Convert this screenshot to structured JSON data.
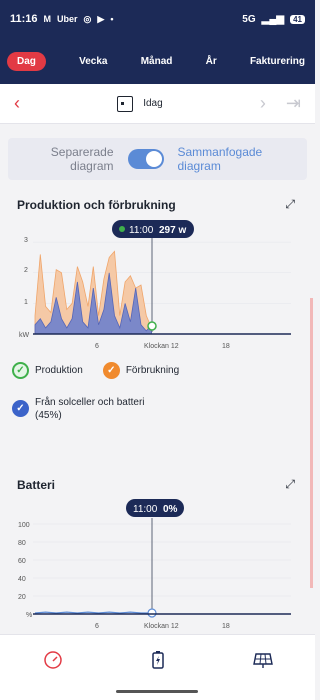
{
  "status": {
    "time": "11:16",
    "icons": [
      "gmail-icon",
      "uber-icon",
      "record-icon",
      "youtube-icon",
      "dot-icon"
    ],
    "uber_label": "Uber",
    "network": "5G",
    "battery": "41"
  },
  "tabs": [
    {
      "label": "Dag",
      "active": true
    },
    {
      "label": "Vecka"
    },
    {
      "label": "Månad"
    },
    {
      "label": "År"
    },
    {
      "label": "Fakturering"
    }
  ],
  "date": {
    "label": "Idag"
  },
  "view": {
    "left": "Separerade diagram",
    "right": "Sammanfogade diagram",
    "toggle_on": true
  },
  "production": {
    "title": "Produktion och förbrukning",
    "tooltip_time": "11:00",
    "tooltip_value": "297 w",
    "y_ticks": [
      "3",
      "2",
      "1",
      "kW"
    ],
    "x_ticks": [
      "6",
      "Klockan 12",
      "18"
    ]
  },
  "legend": {
    "produktion": "Produktion",
    "forbrukning": "Förbrukning",
    "solar_battery": "Från solceller och batteri",
    "solar_battery_pct": "(45%)"
  },
  "battery": {
    "title": "Batteri",
    "tooltip_time": "11:00",
    "tooltip_value": "0%",
    "y_ticks": [
      "100",
      "80",
      "60",
      "40",
      "20",
      "%"
    ],
    "x_ticks": [
      "6",
      "Klockan 12",
      "18"
    ]
  },
  "chart_data": [
    {
      "type": "area",
      "title": "Produktion och förbrukning",
      "ylabel": "kW",
      "ylim": [
        0,
        3.2
      ],
      "x_ticks": [
        "6",
        "Klockan 12",
        "18"
      ],
      "series": [
        {
          "name": "Förbrukning",
          "color": "#f5c9a6",
          "x": [
            0,
            0.5,
            1,
            1.5,
            2,
            2.5,
            3,
            3.5,
            4,
            4.5,
            5,
            5.5,
            6,
            6.5,
            7,
            7.5,
            8,
            8.5,
            9,
            9.5,
            10,
            10.5,
            11
          ],
          "values": [
            0.6,
            2.6,
            0.9,
            0.7,
            2.1,
            2.0,
            0.8,
            1.0,
            2.2,
            1.7,
            0.9,
            2.2,
            0.6,
            1.8,
            2.5,
            2.7,
            0.6,
            1.7,
            1.9,
            1.5,
            1.6,
            0.6,
            0.2
          ]
        },
        {
          "name": "Från solceller och batteri",
          "color": "#7b88c9",
          "x": [
            0,
            0.5,
            1,
            1.5,
            2,
            2.5,
            3,
            3.5,
            4,
            4.5,
            5,
            5.5,
            6,
            6.5,
            7,
            7.5,
            8,
            8.5,
            9,
            9.5,
            10,
            10.5,
            11
          ],
          "values": [
            0.3,
            0.5,
            0.2,
            0.4,
            1.2,
            0.5,
            0.2,
            0.5,
            1.7,
            0.4,
            0.2,
            1.5,
            0.3,
            0.8,
            2.0,
            0.6,
            0.2,
            1.0,
            0.4,
            1.5,
            0.3,
            0.1,
            0.3
          ]
        }
      ]
    },
    {
      "type": "line",
      "title": "Batteri",
      "ylabel": "%",
      "ylim": [
        0,
        100
      ],
      "x_ticks": [
        "6",
        "Klockan 12",
        "18"
      ],
      "series": [
        {
          "name": "Batteri",
          "color": "#5b8bd6",
          "x": [
            0,
            1,
            2,
            3,
            4,
            5,
            6,
            7,
            8,
            9,
            10,
            11
          ],
          "values": [
            0,
            1,
            0,
            1,
            0,
            1,
            0,
            1,
            0,
            1,
            0,
            0
          ]
        }
      ]
    }
  ],
  "colors": {
    "navy": "#1c2a57",
    "accent": "#e23a44",
    "blue": "#5b8bd6"
  }
}
